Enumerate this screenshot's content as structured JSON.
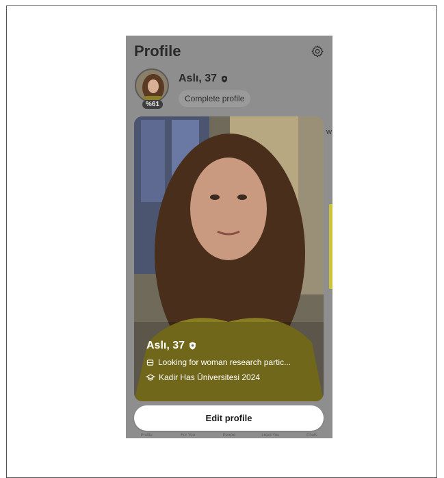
{
  "header": {
    "title": "Profile",
    "settings_icon": "gear-icon"
  },
  "profile": {
    "name_age": "Aslı, 37",
    "badge_icon": "shield-icon",
    "completion": "%61",
    "complete_button": "Complete profile"
  },
  "card": {
    "name_age": "Aslı, 37",
    "looking_for": "Looking for woman research partic...",
    "education": "Kadir Has Üniversitesi 2024"
  },
  "actions": {
    "edit_profile": "Edit profile"
  },
  "tabs": [
    "Profile",
    "For You",
    "People",
    "Liked You",
    "Chats"
  ],
  "peek": {
    "letter": "w"
  },
  "colors": {
    "overlay_bg": "#8e8e8e",
    "accent": "#c9c43a"
  }
}
